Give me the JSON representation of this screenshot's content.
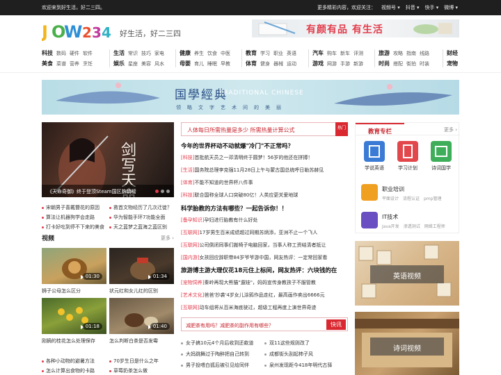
{
  "topbar": {
    "welcome": "欢迎来到好生活，好二三四。",
    "right_items": [
      "更多精彩内容，欢迎关注：",
      "视频号 ▾",
      "抖音 ▾",
      "快手 ▾",
      "微博 ▾"
    ]
  },
  "header": {
    "logo_text": "JOW234",
    "slogan": "好生活，好二三四",
    "banner_text": "有颜有品 有生活"
  },
  "nav": [
    {
      "rows": [
        [
          "科技",
          "数码",
          "硬件",
          "软件"
        ],
        [
          "美食",
          "菜谱",
          "营养",
          "烹饪"
        ]
      ]
    },
    {
      "rows": [
        [
          "生活",
          "常识",
          "技巧",
          "家电"
        ],
        [
          "娱乐",
          "星座",
          "美容",
          "风水"
        ]
      ]
    },
    {
      "rows": [
        [
          "健康",
          "养生",
          "饮食",
          "中医"
        ],
        [
          "母婴",
          "育儿",
          "睡眠",
          "早教"
        ]
      ]
    },
    {
      "rows": [
        [
          "教育",
          "学习",
          "职业",
          "英语"
        ],
        [
          "体育",
          "健身",
          "器械",
          "运动"
        ]
      ]
    },
    {
      "rows": [
        [
          "汽车",
          "购车",
          "新车",
          "评测"
        ],
        [
          "游戏",
          "网游",
          "手游",
          "新游"
        ]
      ]
    },
    {
      "rows": [
        [
          "旅游",
          "攻略",
          "指南",
          "线路"
        ],
        [
          "时尚",
          "搭配",
          "街拍",
          "时装"
        ]
      ]
    },
    {
      "rows": [
        [
          "财经"
        ],
        [
          "宠物"
        ]
      ]
    }
  ],
  "big_banner": {
    "title": "国學經典",
    "en": "TRADITIONAL CHINESE",
    "sub": "领略文字艺术间的美丽"
  },
  "slider": {
    "caption": "《天命奇御》终于登顶Steam国区热销榜",
    "art_text": "剑写天命"
  },
  "left_links": [
    [
      "宋朝男子喜戴簪花的原因",
      "救首文物经历了几次迁徙？"
    ],
    [
      "算法让机器狗学会走路",
      "华为智能手环7功能全面"
    ],
    [
      "打卡好吃到停不下来的美食",
      "天之蓝梦之蓝海之蓝区别"
    ]
  ],
  "video_section": {
    "title": "视频",
    "more": "更多 ›",
    "items": [
      {
        "caption": "狮子公母怎么区分",
        "duration": "01:30"
      },
      {
        "caption": "状元红和女儿红的区别",
        "duration": "01:34"
      },
      {
        "caption": "刚摘的桂花怎么处理保存",
        "duration": "01:18"
      },
      {
        "caption": "怎么判断白茶是否发霉",
        "duration": "01:40"
      }
    ]
  },
  "bottom_left_links": [
    [
      "各种小动物的避暑方法",
      "70岁生日是什么之年"
    ],
    [
      "怎么计算出食物的卡路",
      "草莓奶茶怎么做"
    ]
  ],
  "center": {
    "hot_title": "人体每日所需热量是多少 所需热量计算公式",
    "hot_tag": "热门",
    "news": [
      {
        "tag": "",
        "text": "今年的世界杯动不动就爆\"冷门\"不正常吗？",
        "headline": true
      },
      {
        "tag": "[科技]",
        "text": "首批航天员之一邓清明终于圆梦！56岁的他还在拼搏！",
        "headline": false
      },
      {
        "tag": "[生活]",
        "text": "国务院总理李克强11月28日上午与蒙古国总统呼日勒苏赫见",
        "headline": false
      },
      {
        "tag": "[体育]",
        "text": "不能不知道的世界杯八件事",
        "headline": false
      },
      {
        "tag": "[科技]",
        "text": "联合国称全球人口突破80亿！人类应更关爱地球",
        "headline": false
      },
      {
        "tag": "",
        "text": "科学胎教的方法有哪些？一起告诉你！！",
        "headline": true
      },
      {
        "tag": "[备孕知识]",
        "text": "孕妇进行胎教有什么好处",
        "headline": false
      },
      {
        "tag": "[互联网]",
        "text": "17岁男生百米成绩超过同期苏炳添，亚洲不止一个飞人",
        "headline": false
      },
      {
        "tag": "[互联网]",
        "text": "公司倒闭同事们搬椅子电脑回家，当事人称工资结清者抵让",
        "headline": false
      },
      {
        "tag": "[国内游]",
        "text": "女孩回应辞职带84岁爷爷游中国，网友热评：一定常回家看",
        "headline": false
      },
      {
        "tag": "",
        "text": "旅游博主游大理仅花18元住上标间，网友热评：六块钱的在",
        "headline": true
      },
      {
        "tag": "[宠物饲养]",
        "text": "秦岭再现大熊猫\"遛娃\"，妈妈宣传身教孩子不服管教",
        "headline": false
      },
      {
        "tag": "[艺术文化]",
        "text": "爸爸'抄袭'4岁女儿涂鸦作品走红，最高画作卖出6666元",
        "headline": false
      },
      {
        "tag": "[互联网]",
        "text": "动车组将从百米海底驶过，超级工程再度上演世界奇迹",
        "headline": false
      }
    ],
    "fat_title": "减肥茶有用吗？减肥茶的副作用有哪些？",
    "fat_btn": "快讯",
    "bottom_links": [
      [
        "女子搞10元4个月后收到还款道",
        "双11这些规则改了"
      ],
      [
        "大妈跳舞过于陶醉把自己转到",
        "成都街头刮起柿子风"
      ],
      [
        "男子投喂白狐后被引见给同伴",
        "泉州发现距今418年明代古驿"
      ]
    ]
  },
  "right": {
    "edu_title": "教育专栏",
    "edu_more": "更多 ›",
    "icons": [
      {
        "label": "学说英语",
        "color": "#3a7bd5"
      },
      {
        "label": "学习计划",
        "color": "#e2474b"
      },
      {
        "label": "诗词国学",
        "color": "#3fae5a"
      }
    ],
    "wide_items": [
      {
        "title": "职业培训",
        "subs": [
          "平面设计",
          "流程认证",
          "pmp管理"
        ],
        "color": "#f0a020"
      },
      {
        "title": "IT技术",
        "subs": [
          "Java开发",
          "渗透测试",
          "网络工程师"
        ],
        "color": "#6a4fc2"
      }
    ],
    "cards": [
      {
        "label": "英语视频"
      },
      {
        "label": "诗词视频"
      }
    ]
  }
}
